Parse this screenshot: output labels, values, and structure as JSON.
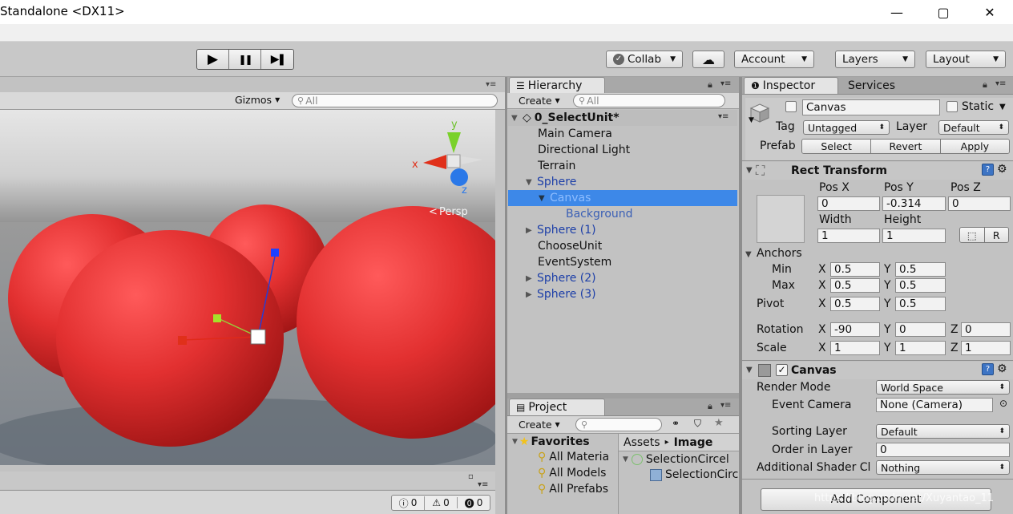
{
  "window": {
    "title": "Standalone <DX11>",
    "minimize_glyph": "—",
    "maximize_glyph": "▢",
    "close_glyph": "✕"
  },
  "toolbar": {
    "play_glyph": "▶",
    "pause_glyph": "❚❚",
    "step_glyph": "▶❚",
    "collab_label": "Collab",
    "account_label": "Account",
    "layers_label": "Layers",
    "layout_label": "Layout"
  },
  "scene": {
    "gizmos_label": "Gizmos",
    "search_placeholder": "All",
    "persp_label": "Persp",
    "axis_y": "y",
    "axis_x": "x",
    "axis_z": "z",
    "colors": {
      "sphere": "#d82a2a",
      "sky": "#d8d8d8",
      "ground": "#8d939b"
    }
  },
  "console": {
    "info_count": "0",
    "warn_count": "0",
    "error_count": "0"
  },
  "hierarchy": {
    "tab_label": "Hierarchy",
    "create_label": "Create",
    "search_placeholder": "All",
    "scene_name": "0_SelectUnit*",
    "items": [
      {
        "label": "Main Camera"
      },
      {
        "label": "Directional Light"
      },
      {
        "label": "Terrain"
      },
      {
        "label": "Sphere"
      },
      {
        "label": "Canvas"
      },
      {
        "label": "Background"
      },
      {
        "label": "Sphere (1)"
      },
      {
        "label": "ChooseUnit"
      },
      {
        "label": "EventSystem"
      },
      {
        "label": "Sphere (2)"
      },
      {
        "label": "Sphere (3)"
      }
    ]
  },
  "project": {
    "tab_label": "Project",
    "create_label": "Create",
    "favorites_label": "Favorites",
    "favorites": [
      "All Materia",
      "All Models",
      "All Prefabs"
    ],
    "breadcrumb_root": "Assets",
    "breadcrumb_leaf": "Image",
    "files": [
      "SelectionCircel",
      "SelectionCirc"
    ]
  },
  "inspector": {
    "tab_label": "Inspector",
    "services_label": "Services",
    "object_name": "Canvas",
    "static_label": "Static",
    "tag_label": "Tag",
    "tag_value": "Untagged",
    "layer_label": "Layer",
    "layer_value": "Default",
    "prefab_label": "Prefab",
    "select_label": "Select",
    "revert_label": "Revert",
    "apply_label": "Apply",
    "rect_transform": {
      "title": "Rect Transform",
      "pos_x_label": "Pos X",
      "pos_y_label": "Pos Y",
      "pos_z_label": "Pos Z",
      "pos_x": "0",
      "pos_y": "-0.314",
      "pos_z": "0",
      "width_label": "Width",
      "height_label": "Height",
      "width": "1",
      "height": "1",
      "r_label": "R",
      "anchors_label": "Anchors",
      "min_label": "Min",
      "max_label": "Max",
      "pivot_label": "Pivot",
      "min_x": "0.5",
      "min_y": "0.5",
      "max_x": "0.5",
      "max_y": "0.5",
      "pivot_x": "0.5",
      "pivot_y": "0.5",
      "rotation_label": "Rotation",
      "rot_x": "-90",
      "rot_y": "0",
      "rot_z": "0",
      "scale_label": "Scale",
      "scale_x": "1",
      "scale_y": "1",
      "scale_z": "1",
      "x_label": "X",
      "y_label": "Y",
      "z_label": "Z"
    },
    "canvas": {
      "title": "Canvas",
      "render_mode_label": "Render Mode",
      "render_mode_value": "World Space",
      "event_camera_label": "Event Camera",
      "event_camera_value": "None (Camera)",
      "sorting_layer_label": "Sorting Layer",
      "sorting_layer_value": "Default",
      "order_label": "Order in Layer",
      "order_value": "0",
      "shader_label": "Additional Shader Cl",
      "shader_value": "Nothing"
    },
    "add_component_label": "Add Component",
    "watermark": "https://blog.csdn.net/Xuyantao_11"
  }
}
